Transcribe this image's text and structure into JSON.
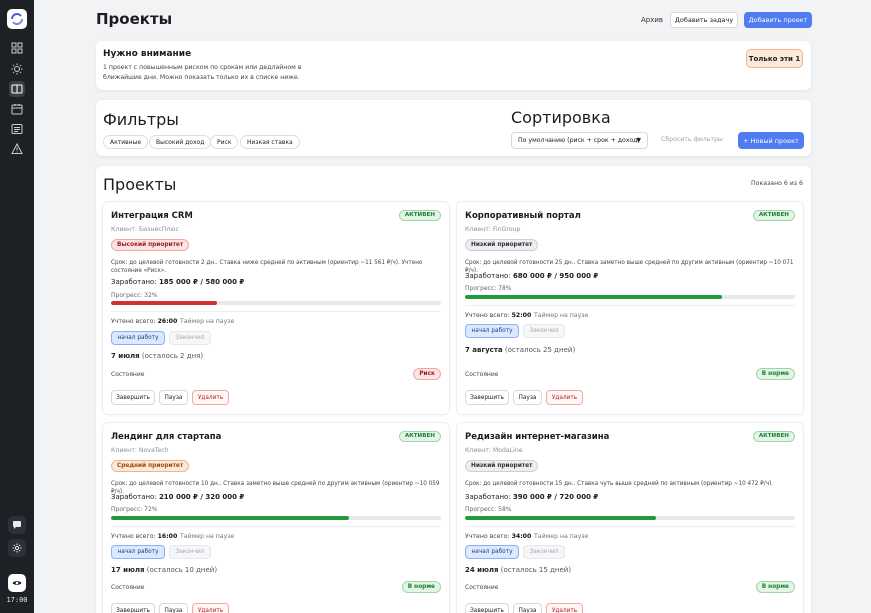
{
  "sidebar": {
    "icons": [
      "dashboard-icon",
      "sun-icon",
      "projects-icon",
      "calendar-icon",
      "invoices-icon",
      "warning-icon"
    ],
    "bottom_icons": [
      "chat-icon",
      "settings-icon",
      "eye-icon"
    ],
    "time": "17:00"
  },
  "header": {
    "title": "Проекты",
    "archive_label": "Архив",
    "add_task_label": "Добавить задачу",
    "add_project_label": "Добавить проект"
  },
  "attention": {
    "title": "Нужно внимание",
    "text": "1 проект с повышенным риском по срокам или дедлайном в ближайшие дни. Можно показать только их в списке ниже.",
    "button_label": "Только эти 1"
  },
  "filters": {
    "title": "Фильтры",
    "chips": [
      "Активные",
      "Высокий доход",
      "Риск",
      "Низкая ставка"
    ],
    "sort_title": "Сортировка",
    "sort_value": "По умолчанию (риск + срок + доход)",
    "reset_label": "Сбросить фильтры",
    "new_project_label": "+ Новый проект"
  },
  "projects": {
    "title": "Проекты",
    "count": "Показано 6 из 6",
    "items": [
      {
        "name": "Интеграция CRM",
        "status": "АКТИВЕН",
        "client": "Клиент: БизнесПлюс",
        "priority": "Высокий приоритет",
        "priority_level": "high",
        "desc": "Срок: до целевой готовности 2 дн.. Ставка ниже средней по активным (ориентир ~11 561 ₽/ч). Учтено состояние «Риск».",
        "earned_label": "Заработано:",
        "earned_value": "185 000 ₽ / 580 000 ₽",
        "progress_label": "Прогресс: 32%",
        "progress": 32,
        "bar_color": "#d3302f",
        "tracked_label": "Учтено всего:",
        "tracked_value": "26:00",
        "timer_label": "Таймер на паузе",
        "start_label": "начал работу",
        "finish_label": "Закончил",
        "date_main": "7 июля",
        "date_rest": "(осталось 2 дня)",
        "state_label": "Состояние",
        "state_badge": "Риск",
        "state_kind": "risk",
        "btn_done": "Завершить",
        "btn_pause": "Пауза",
        "btn_delete": "Удалить"
      },
      {
        "name": "Корпоративный портал",
        "status": "АКТИВЕН",
        "client": "Клиент: FinGroup",
        "priority": "Низкий приоритет",
        "priority_level": "low",
        "desc": "Срок: до целевой готовности 25 дн.. Ставка заметно выше средней по другим активным (ориентир ~10 071 ₽/ч).",
        "earned_label": "Заработано:",
        "earned_value": "680 000 ₽ / 950 000 ₽",
        "progress_label": "Прогресс: 78%",
        "progress": 78,
        "bar_color": "#1f9b3c",
        "tracked_label": "Учтено всего:",
        "tracked_value": "52:00",
        "timer_label": "Таймер на паузе",
        "start_label": "начал работу",
        "finish_label": "Закончил",
        "date_main": "7 августа",
        "date_rest": "(осталось 25 дней)",
        "state_label": "Состояние",
        "state_badge": "В норме",
        "state_kind": "ok",
        "btn_done": "Завершить",
        "btn_pause": "Пауза",
        "btn_delete": "Удалить"
      },
      {
        "name": "Лендинг для стартапа",
        "status": "АКТИВЕН",
        "client": "Клиент: NovaTech",
        "priority": "Средний приоритет",
        "priority_level": "mid",
        "desc": "Срок: до целевой готовности 10 дн.. Ставка заметно выше средней по другим активным (ориентир ~10 059 ₽/ч).",
        "earned_label": "Заработано:",
        "earned_value": "210 000 ₽ / 320 000 ₽",
        "progress_label": "Прогресс: 72%",
        "progress": 72,
        "bar_color": "#1f9b3c",
        "tracked_label": "Учтено всего:",
        "tracked_value": "16:00",
        "timer_label": "Таймер на паузе",
        "start_label": "начал работу",
        "finish_label": "Закончил",
        "date_main": "17 июля",
        "date_rest": "(осталось 10 дней)",
        "state_label": "Состояние",
        "state_badge": "В норме",
        "state_kind": "ok",
        "btn_done": "Завершить",
        "btn_pause": "Пауза",
        "btn_delete": "Удалить"
      },
      {
        "name": "Редизайн интернет-магазина",
        "status": "АКТИВЕН",
        "client": "Клиент: ModaLine",
        "priority": "Низкий приоритет",
        "priority_level": "low",
        "desc": "Срок: до целевой готовности 15 дн.. Ставка чуть выше средней по активным (ориентир ~10 472 ₽/ч).",
        "earned_label": "Заработано:",
        "earned_value": "390 000 ₽ / 720 000 ₽",
        "progress_label": "Прогресс: 58%",
        "progress": 58,
        "bar_color": "#1f9b3c",
        "tracked_label": "Учтено всего:",
        "tracked_value": "34:00",
        "timer_label": "Таймер на паузе",
        "start_label": "начал работу",
        "finish_label": "Закончил",
        "date_main": "24 июля",
        "date_rest": "(осталось 15 дней)",
        "state_label": "Состояние",
        "state_badge": "В норме",
        "state_kind": "ok",
        "btn_done": "Завершить",
        "btn_pause": "Пауза",
        "btn_delete": "Удалить"
      }
    ]
  }
}
